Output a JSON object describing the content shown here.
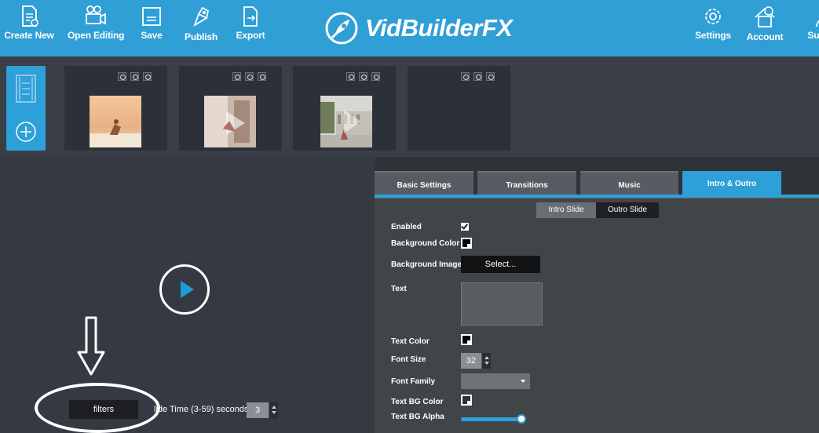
{
  "toolbar": {
    "create_new": "Create New",
    "open_editing": "Open Editing",
    "save": "Save",
    "publish": "Publish",
    "export": "Export",
    "settings": "Settings",
    "account": "Account",
    "support": "Supp"
  },
  "brand": {
    "name": "VidBuilderFX",
    "logo": "rocket-logo-icon"
  },
  "slides": [
    {
      "thumb": "slide-thumbnail-yoga-beach",
      "controls": [
        "lock-icon",
        "refresh-icon",
        "close-icon"
      ]
    },
    {
      "thumb": "slide-thumbnail-yoga-transition",
      "controls": [
        "lock-icon",
        "refresh-icon",
        "close-icon"
      ]
    },
    {
      "thumb": "slide-thumbnail-yoga-street",
      "controls": [
        "lock-icon",
        "refresh-icon",
        "close-icon"
      ]
    },
    {
      "thumb": "",
      "controls": [
        "lock-icon",
        "refresh-icon",
        "close-icon"
      ]
    }
  ],
  "strip_side": {
    "top_icon": "filmstrip-icon",
    "bottom_icon": "add-circle-icon"
  },
  "preview": {
    "filters_label": "filters",
    "slide_time_label": "lide Time (3-59) seconds:",
    "slide_time_value": "3"
  },
  "tabs": [
    {
      "label": "Basic Settings",
      "active": false
    },
    {
      "label": "Transitions",
      "active": false
    },
    {
      "label": "Music",
      "active": false
    },
    {
      "label": "Intro & Outro",
      "active": true
    }
  ],
  "sub_tabs": {
    "intro": "Intro Slide",
    "outro": "Outro Slide",
    "active": "intro"
  },
  "form": {
    "enabled_label": "Enabled",
    "enabled_checked": true,
    "bg_color_label": "Background Color",
    "bg_image_label": "Background Image",
    "bg_image_button": "Select...",
    "text_label": "Text",
    "text_value": "",
    "text_color_label": "Text Color",
    "font_size_label": "Font Size",
    "font_size_value": "32",
    "font_family_label": "Font Family",
    "font_family_value": "",
    "text_bg_color_label": "Text BG Color",
    "text_bg_alpha_label": "Text BG Alpha",
    "text_bg_alpha": 1.0
  },
  "colors": {
    "accent": "#2d9fd9",
    "topbar": "#2f9fd6",
    "panel": "#424548",
    "dark": "#353a42"
  }
}
